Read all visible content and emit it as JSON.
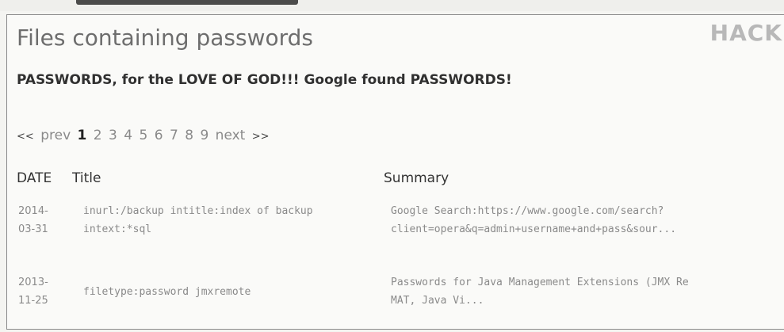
{
  "logo": {
    "text": "HACK"
  },
  "page": {
    "title": "Files containing passwords",
    "subtitle": "PASSWORDS, for the LOVE OF GOD!!! Google found PASSWORDS!"
  },
  "pager": {
    "prev_arrows": "<<",
    "prev_label": "prev",
    "pages": [
      "1",
      "2",
      "3",
      "4",
      "5",
      "6",
      "7",
      "8",
      "9"
    ],
    "current_page": "1",
    "next_label": "next",
    "next_arrows": ">>"
  },
  "table": {
    "headers": {
      "date": "DATE",
      "title": "Title",
      "summary": "Summary"
    },
    "rows": [
      {
        "date_line1": "2014-",
        "date_line2": "03-31",
        "title_line1": "inurl:/backup intitle:index of backup",
        "title_line2": "intext:*sql",
        "summary_line1": "Google Search:https://www.google.com/search?",
        "summary_line2": "client=opera&q=admin+username+and+pass&sour..."
      },
      {
        "date_line1": "2013-",
        "date_line2": "11-25",
        "title_line1": "filetype:password jmxremote",
        "summary_line1": "Passwords for Java Management Extensions (JMX Re",
        "summary_line2": "MAT, Java Vi..."
      }
    ]
  }
}
